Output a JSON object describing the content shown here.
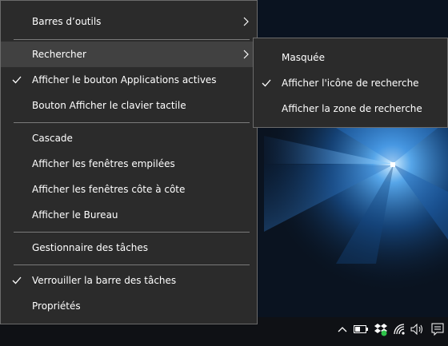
{
  "context_menu": {
    "items": [
      {
        "label": "Barres d’outils",
        "submenu": true
      },
      {
        "label": "Rechercher",
        "submenu": true,
        "highlighted": true
      },
      {
        "label": "Afficher le bouton Applications actives",
        "checked": true
      },
      {
        "label": "Bouton Afficher le clavier tactile"
      },
      {
        "label": "Cascade"
      },
      {
        "label": "Afficher les fenêtres empilées"
      },
      {
        "label": "Afficher les fenêtres côte à côte"
      },
      {
        "label": "Afficher le Bureau"
      },
      {
        "label": "Gestionnaire des tâches"
      },
      {
        "label": "Verrouiller la barre des tâches",
        "checked": true
      },
      {
        "label": "Propriétés"
      }
    ]
  },
  "search_submenu": {
    "items": [
      {
        "label": "Masquée"
      },
      {
        "label": "Afficher l'icône de recherche",
        "checked": true
      },
      {
        "label": "Afficher la zone de recherche"
      }
    ]
  },
  "taskbar": {
    "tray_icons": [
      "chevron-up-icon",
      "battery-icon",
      "dropbox-icon",
      "wifi-icon",
      "volume-icon",
      "action-center-icon"
    ]
  },
  "colors": {
    "menu_bg": "#2b2b2b",
    "menu_hover": "#414141",
    "menu_border": "#6b6b6b",
    "text": "#ffffff",
    "taskbar_bg": "#0f1115",
    "wallpaper_light": "#4aa3ff"
  }
}
